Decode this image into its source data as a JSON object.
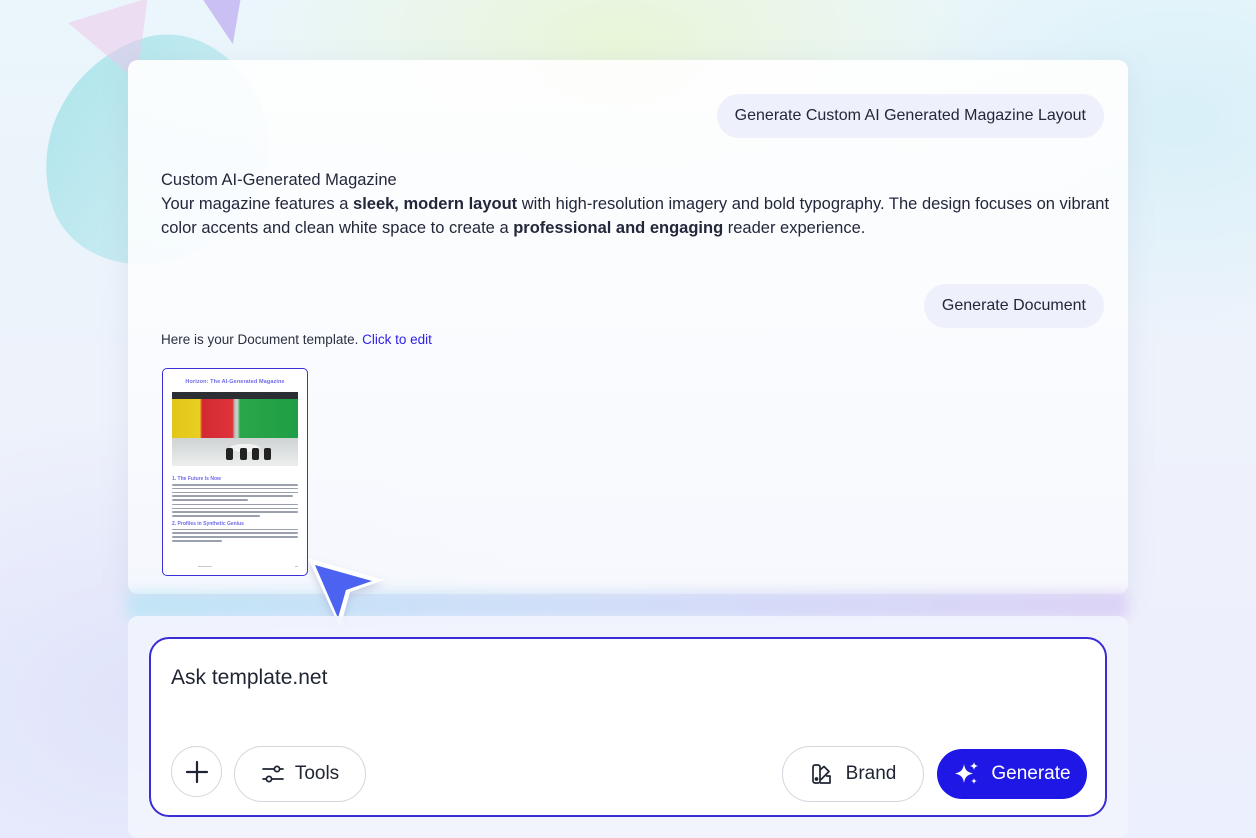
{
  "chat": {
    "messages": [
      {
        "role": "user",
        "text": "Generate Custom AI Generated Magazine Layout"
      },
      {
        "role": "assistant",
        "title": "Custom AI-Generated Magazine",
        "body_parts": [
          {
            "text": "Your magazine features a ",
            "bold": false
          },
          {
            "text": "sleek, modern layout",
            "bold": true
          },
          {
            "text": " with high-resolution imagery and bold typography. The design focuses on vibrant color accents and clean white space to create a ",
            "bold": false
          },
          {
            "text": "professional and engaging",
            "bold": true
          },
          {
            "text": " reader experience.",
            "bold": false
          }
        ]
      },
      {
        "role": "user",
        "text": "Generate Document"
      },
      {
        "role": "assistant",
        "note_text": "Here is your Document template. ",
        "note_link": "Click to edit"
      }
    ]
  },
  "document_preview": {
    "title": "Horizon: The AI-Generated Magazine",
    "section_1": "1. The Future Is Now",
    "section_2": "2. Profiles in Synthetic Genius",
    "image_alt": "colorful office meeting room"
  },
  "composer": {
    "placeholder": "Ask template.net",
    "value": "",
    "tools_label": "Tools",
    "brand_label": "Brand",
    "generate_label": "Generate"
  },
  "icons": {
    "add": "plus-icon",
    "tools": "sliders-icon",
    "brand": "palette-icon",
    "generate": "sparkle-icon",
    "pointer": "cursor-arrow-icon"
  },
  "colors": {
    "accent": "#1f17e6",
    "composer_border": "#3a2dd4",
    "link": "#2b1ee6",
    "bubble_bg": "#eef0fb"
  }
}
